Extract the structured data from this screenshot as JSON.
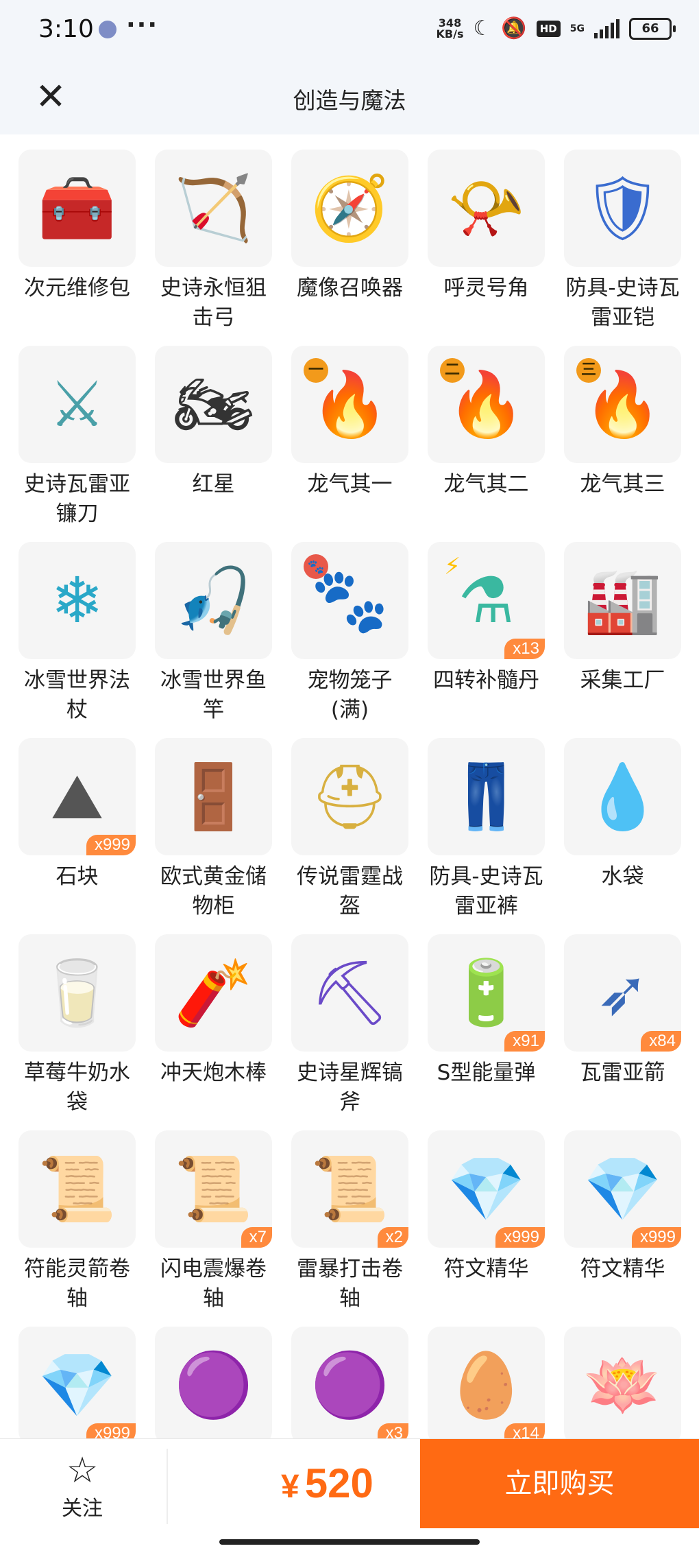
{
  "status_bar": {
    "time": "3:10",
    "net_speed_value": "348",
    "net_speed_unit": "KB/s",
    "signal_label": "5G",
    "battery": "66",
    "hd_label": "HD"
  },
  "header": {
    "title": "创造与魔法",
    "close_icon": "close-icon"
  },
  "items": [
    {
      "name": "次元维修包",
      "qty": "",
      "icon": "🧰",
      "color": "#8b5a2b",
      "tag": ""
    },
    {
      "name": "史诗永恒狙击弓",
      "qty": "",
      "icon": "🏹",
      "color": "#9ab0d8",
      "tag": ""
    },
    {
      "name": "魔像召唤器",
      "qty": "",
      "icon": "🧭",
      "color": "#d6a52a",
      "tag": ""
    },
    {
      "name": "呼灵号角",
      "qty": "",
      "icon": "📯",
      "color": "#c85a5a",
      "tag": ""
    },
    {
      "name": "防具-史诗瓦雷亚铠",
      "qty": "",
      "icon": "🛡",
      "color": "#3a6ccf",
      "tag": ""
    },
    {
      "name": "史诗瓦雷亚镰刀",
      "qty": "",
      "icon": "⚔",
      "color": "#4aa0a8",
      "tag": ""
    },
    {
      "name": "红星",
      "qty": "",
      "icon": "🏍",
      "color": "#333333",
      "tag": ""
    },
    {
      "name": "龙气其一",
      "qty": "",
      "icon": "🔥",
      "color": "#e2a21a",
      "tag": "一"
    },
    {
      "name": "龙气其二",
      "qty": "",
      "icon": "🔥",
      "color": "#e2a21a",
      "tag": "二"
    },
    {
      "name": "龙气其三",
      "qty": "",
      "icon": "🔥",
      "color": "#e2a21a",
      "tag": "三"
    },
    {
      "name": "冰雪世界法杖",
      "qty": "",
      "icon": "❄",
      "color": "#2aa8c8",
      "tag": ""
    },
    {
      "name": "冰雪世界鱼竿",
      "qty": "",
      "icon": "🎣",
      "color": "#7a9ad8",
      "tag": ""
    },
    {
      "name": "宠物笼子(满)",
      "qty": "",
      "icon": "🐾",
      "color": "#555555",
      "tag": "🐾"
    },
    {
      "name": "四转补髓丹",
      "qty": "x13",
      "icon": "⚗",
      "color": "#3ab8a0",
      "tag": "⚡"
    },
    {
      "name": "采集工厂",
      "qty": "",
      "icon": "🏭",
      "color": "#444444",
      "tag": ""
    },
    {
      "name": "石块",
      "qty": "x999",
      "icon": "⛰",
      "color": "#555555",
      "tag": ""
    },
    {
      "name": "欧式黄金储物柜",
      "qty": "",
      "icon": "🚪",
      "color": "#b8c8e0",
      "tag": ""
    },
    {
      "name": "传说雷霆战盔",
      "qty": "",
      "icon": "⛑",
      "color": "#d8b040",
      "tag": ""
    },
    {
      "name": "防具-史诗瓦雷亚裤",
      "qty": "",
      "icon": "👖",
      "color": "#2a5ab8",
      "tag": ""
    },
    {
      "name": "水袋",
      "qty": "",
      "icon": "💧",
      "color": "#a8692a",
      "tag": ""
    },
    {
      "name": "草莓牛奶水袋",
      "qty": "",
      "icon": "🥛",
      "color": "#e88aa0",
      "tag": ""
    },
    {
      "name": "冲天炮木棒",
      "qty": "",
      "icon": "🧨",
      "color": "#c83a2a",
      "tag": ""
    },
    {
      "name": "史诗星辉镐斧",
      "qty": "",
      "icon": "⛏",
      "color": "#6a4ac8",
      "tag": ""
    },
    {
      "name": "S型能量弹",
      "qty": "x91",
      "icon": "🔋",
      "color": "#3a7ad8",
      "tag": ""
    },
    {
      "name": "瓦雷亚箭",
      "qty": "x84",
      "icon": "➶",
      "color": "#3a6ab8",
      "tag": ""
    },
    {
      "name": "符能灵箭卷轴",
      "qty": "",
      "icon": "📜",
      "color": "#222222",
      "tag": ""
    },
    {
      "name": "闪电震爆卷轴",
      "qty": "x7",
      "icon": "📜",
      "color": "#222222",
      "tag": ""
    },
    {
      "name": "雷暴打击卷轴",
      "qty": "x2",
      "icon": "📜",
      "color": "#222222",
      "tag": ""
    },
    {
      "name": "符文精华",
      "qty": "x999",
      "icon": "💎",
      "color": "#3a8ae8",
      "tag": ""
    },
    {
      "name": "符文精华",
      "qty": "x999",
      "icon": "💎",
      "color": "#3a8ae8",
      "tag": ""
    },
    {
      "name": "",
      "qty": "x999",
      "icon": "💎",
      "color": "#3a8ae8",
      "tag": ""
    },
    {
      "name": "",
      "qty": "",
      "icon": "🟣",
      "color": "#7a3ac8",
      "tag": ""
    },
    {
      "name": "",
      "qty": "x3",
      "icon": "🟣",
      "color": "#7a3ac8",
      "tag": ""
    },
    {
      "name": "",
      "qty": "x14",
      "icon": "🥚",
      "color": "#d8a860",
      "tag": ""
    },
    {
      "name": "",
      "qty": "",
      "icon": "🪷",
      "color": "#8ac0e0",
      "tag": ""
    }
  ],
  "bottom": {
    "follow_label": "关注",
    "currency": "¥",
    "price": "520",
    "buy_label": "立即购买",
    "accent": "#ff6a13"
  }
}
